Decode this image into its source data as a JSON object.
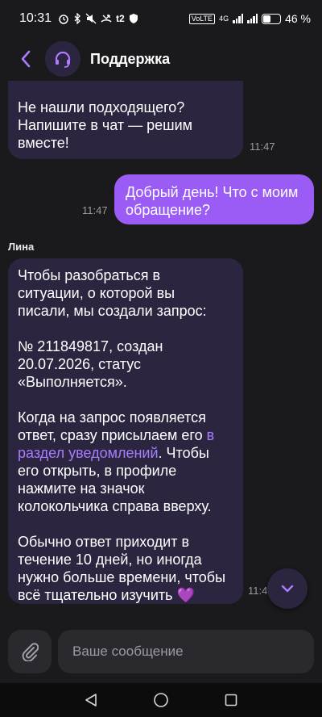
{
  "status_bar": {
    "time": "10:31",
    "carrier": "t2",
    "network": "4G",
    "volte": "VoLTE",
    "battery_text": "46 %",
    "battery_level": 0.46
  },
  "header": {
    "title": "Поддержка"
  },
  "messages": [
    {
      "direction": "in",
      "text": "Не нашли подходящего?\nНапишите в чат — решим\nвместе!",
      "time": "11:47"
    },
    {
      "direction": "out",
      "text": "Добрый день! Что с моим\nобращение?",
      "time": "11:47"
    },
    {
      "direction": "in",
      "sender": "Лина",
      "text_part1": "Чтобы разобраться в\nситуации, о которой вы\nписали, мы создали запрос:\n\n№ 211849817, создан\n20.07.2026, статус\n«Выполняется».\n\nКогда на запрос появляется\nответ, сразу присылаем его ",
      "link_text": "в\nраздел уведомлений",
      "text_part2": ". Чтобы\nего открыть, в профиле\nнажмите на значок\nколокольчика справа вверху.\n\nОбычно ответ приходит в\nтечение 10 дней, но иногда\nнужно больше времени, чтобы\nвсё тщательно изучить 💜",
      "time": "11:47"
    }
  ],
  "input": {
    "placeholder": "Ваше сообщение"
  },
  "colors": {
    "background": "#1a1a1c",
    "bubble_in": "#2b2540",
    "bubble_out": "#9b5cf6",
    "accent": "#a97cff"
  },
  "icons": {
    "back": "chevron-left-icon",
    "avatar": "headset-icon",
    "scroll_down": "chevron-down-icon",
    "attach": "paperclip-icon",
    "nav_back": "triangle-back-icon",
    "nav_home": "circle-home-icon",
    "nav_recents": "square-recents-icon"
  }
}
